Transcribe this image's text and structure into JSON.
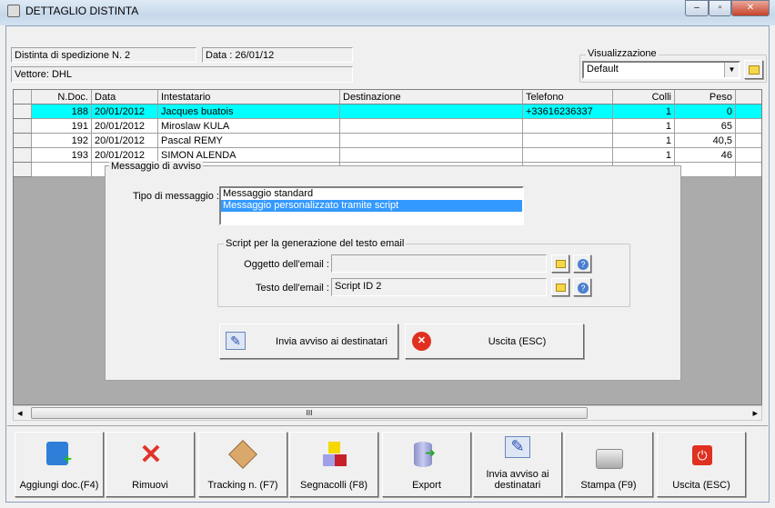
{
  "window": {
    "title": "DETTAGLIO DISTINTA"
  },
  "header": {
    "distinta": "Distinta di spedizione N. 2",
    "data": "Data : 26/01/12",
    "vettore": "Vettore: DHL"
  },
  "visualizzazione": {
    "label": "Visualizzazione",
    "value": "Default"
  },
  "table": {
    "columns": [
      "N.Doc.",
      "Data",
      "Intestatario",
      "Destinazione",
      "Telefono",
      "Colli",
      "Peso"
    ],
    "rows": [
      {
        "ndoc": "188",
        "data": "20/01/2012",
        "intestatario": "Jacques buatois",
        "destinazione": "",
        "telefono": "+33616236337",
        "colli": "1",
        "peso": "0"
      },
      {
        "ndoc": "191",
        "data": "20/01/2012",
        "intestatario": "Miroslaw KULA",
        "destinazione": "",
        "telefono": "",
        "colli": "1",
        "peso": "65"
      },
      {
        "ndoc": "192",
        "data": "20/01/2012",
        "intestatario": "Pascal REMY",
        "destinazione": "",
        "telefono": "",
        "colli": "1",
        "peso": "40,5"
      },
      {
        "ndoc": "193",
        "data": "20/01/2012",
        "intestatario": "SIMON ALENDA",
        "destinazione": "",
        "telefono": "",
        "colli": "1",
        "peso": "46"
      }
    ]
  },
  "dialog": {
    "legend": "Messaggio di avviso",
    "tipo_label": "Tipo di messaggio :",
    "tipo_options": [
      "Messaggio standard",
      "Messaggio personalizzato tramite script"
    ],
    "script_legend": "Script per la generazione del testo email",
    "oggetto_label": "Oggetto dell'email :",
    "oggetto_value": "",
    "testo_label": "Testo dell'email :",
    "testo_value": "Script ID 2",
    "send_label": "Invia avviso ai destinatari",
    "exit_label": "Uscita (ESC)"
  },
  "scrollbar": {
    "grip": "III"
  },
  "toolbar": [
    {
      "label": "Aggiungi doc.(F4)",
      "icon": "add-document-icon"
    },
    {
      "label": "Rimuovi",
      "icon": "remove-x-icon"
    },
    {
      "label": "Tracking n. (F7)",
      "icon": "package-icon"
    },
    {
      "label": "Segnacolli (F8)",
      "icon": "cubes-icon"
    },
    {
      "label": "Export",
      "icon": "database-export-icon"
    },
    {
      "label": "Invia avviso ai destinatari",
      "icon": "mail-pen-icon"
    },
    {
      "label": "Stampa (F9)",
      "icon": "printer-icon"
    },
    {
      "label": "Uscita (ESC)",
      "icon": "power-icon"
    }
  ],
  "colors": {
    "selected_row": "#00ffff",
    "list_selection": "#3399ff"
  }
}
